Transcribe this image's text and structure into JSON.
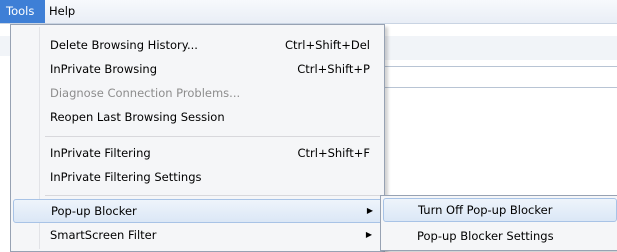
{
  "menubar": {
    "tools_label": "Tools",
    "help_label": "Help"
  },
  "tools_menu": {
    "items": [
      {
        "label": "Delete Browsing History...",
        "shortcut": "Ctrl+Shift+Del"
      },
      {
        "label": "InPrivate Browsing",
        "shortcut": "Ctrl+Shift+P"
      },
      {
        "label": "Diagnose Connection Problems...",
        "shortcut": "",
        "disabled": true
      },
      {
        "label": "Reopen Last Browsing Session",
        "shortcut": ""
      },
      {
        "label": "InPrivate Filtering",
        "shortcut": "Ctrl+Shift+F"
      },
      {
        "label": "InPrivate Filtering Settings",
        "shortcut": ""
      },
      {
        "label": "Pop-up Blocker",
        "shortcut": "",
        "submenu": true,
        "highlighted": true
      },
      {
        "label": "SmartScreen Filter",
        "shortcut": "",
        "submenu": true
      }
    ]
  },
  "popup_submenu": {
    "items": [
      {
        "label": "Turn Off Pop-up Blocker",
        "highlighted": true
      },
      {
        "label": "Pop-up Blocker Settings"
      }
    ]
  },
  "colors": {
    "active_menu": "#3e7fd6",
    "highlight_border": "#a8c3e6",
    "disabled_text": "#8d8d8d"
  },
  "icons": {
    "submenu_arrow": "chevron-right-icon"
  }
}
